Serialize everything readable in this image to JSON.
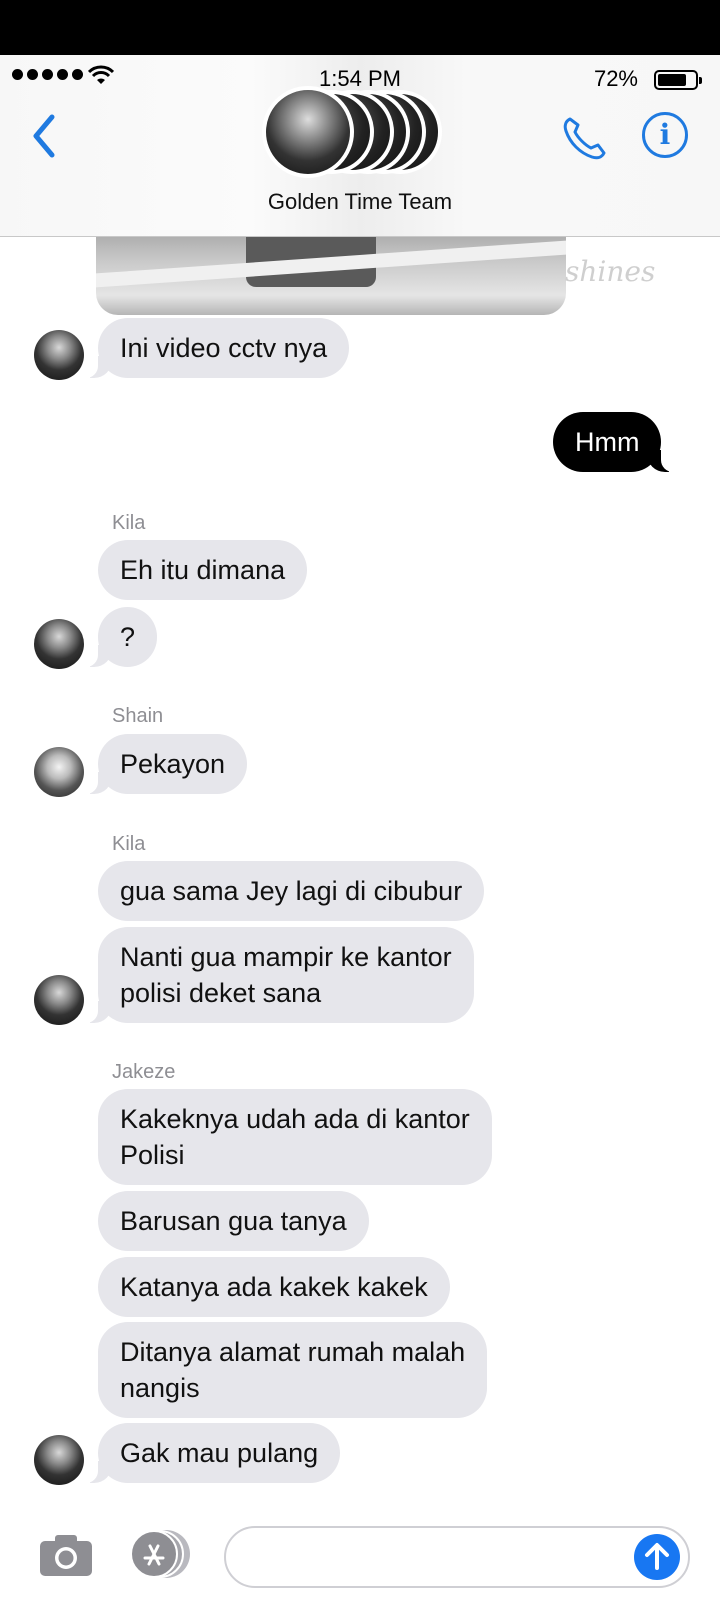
{
  "status_bar": {
    "time": "1:54 PM",
    "battery": "72%",
    "battery_fill_fraction": 0.72
  },
  "header": {
    "title": "Golden Time Team",
    "back_icon": "chevron-left-icon",
    "call_icon": "phone-icon",
    "info_icon": "info-icon",
    "info_glyph": "i",
    "accent_color": "#1f7ae0"
  },
  "watermark": "shines",
  "messages": [
    {
      "type": "image",
      "sender": ""
    },
    {
      "type": "text",
      "direction": "in",
      "sender": "",
      "text": "Ini video cctv nya"
    },
    {
      "type": "text",
      "direction": "out",
      "text": "Hmm"
    },
    {
      "type": "sender",
      "name": "Kila"
    },
    {
      "type": "text",
      "direction": "in",
      "text": "Eh itu dimana"
    },
    {
      "type": "text",
      "direction": "in",
      "text": "?"
    },
    {
      "type": "sender",
      "name": "Shain"
    },
    {
      "type": "text",
      "direction": "in",
      "text": "Pekayon"
    },
    {
      "type": "sender",
      "name": "Kila"
    },
    {
      "type": "text",
      "direction": "in",
      "text": "gua sama Jey lagi di cibubur"
    },
    {
      "type": "text",
      "direction": "in",
      "text": "Nanti gua mampir ke kantor\npolisi deket sana"
    },
    {
      "type": "sender",
      "name": "Jakeze"
    },
    {
      "type": "text",
      "direction": "in",
      "text": "Kakeknya udah ada di kantor\nPolisi"
    },
    {
      "type": "text",
      "direction": "in",
      "text": "Barusan gua tanya"
    },
    {
      "type": "text",
      "direction": "in",
      "text": "Katanya ada kakek kakek"
    },
    {
      "type": "text",
      "direction": "in",
      "text": "Ditanya alamat rumah malah\nnangis"
    },
    {
      "type": "text",
      "direction": "in",
      "text": "Gak mau pulang"
    }
  ],
  "labels": {
    "m1": "Ini video cctv nya",
    "m2": "Hmm",
    "s1": "Kila",
    "m3": "Eh itu dimana",
    "m4": "?",
    "s2": "Shain",
    "m5": "Pekayon",
    "s3": "Kila",
    "m6": "gua sama Jey lagi di cibubur",
    "m7a": "Nanti gua mampir ke kantor",
    "m7b": "polisi deket sana",
    "s4": "Jakeze",
    "m8a": "Kakeknya udah ada di kantor",
    "m8b": "Polisi",
    "m9": "Barusan gua tanya",
    "m10": "Katanya ada kakek kakek",
    "m11a": "Ditanya alamat rumah malah",
    "m11b": "nangis",
    "m12": "Gak mau pulang"
  },
  "composer": {
    "camera_icon": "camera-icon",
    "apps_icon": "app-store-icon",
    "send_icon": "arrow-up-icon",
    "placeholder": "",
    "send_color": "#1877f2"
  }
}
